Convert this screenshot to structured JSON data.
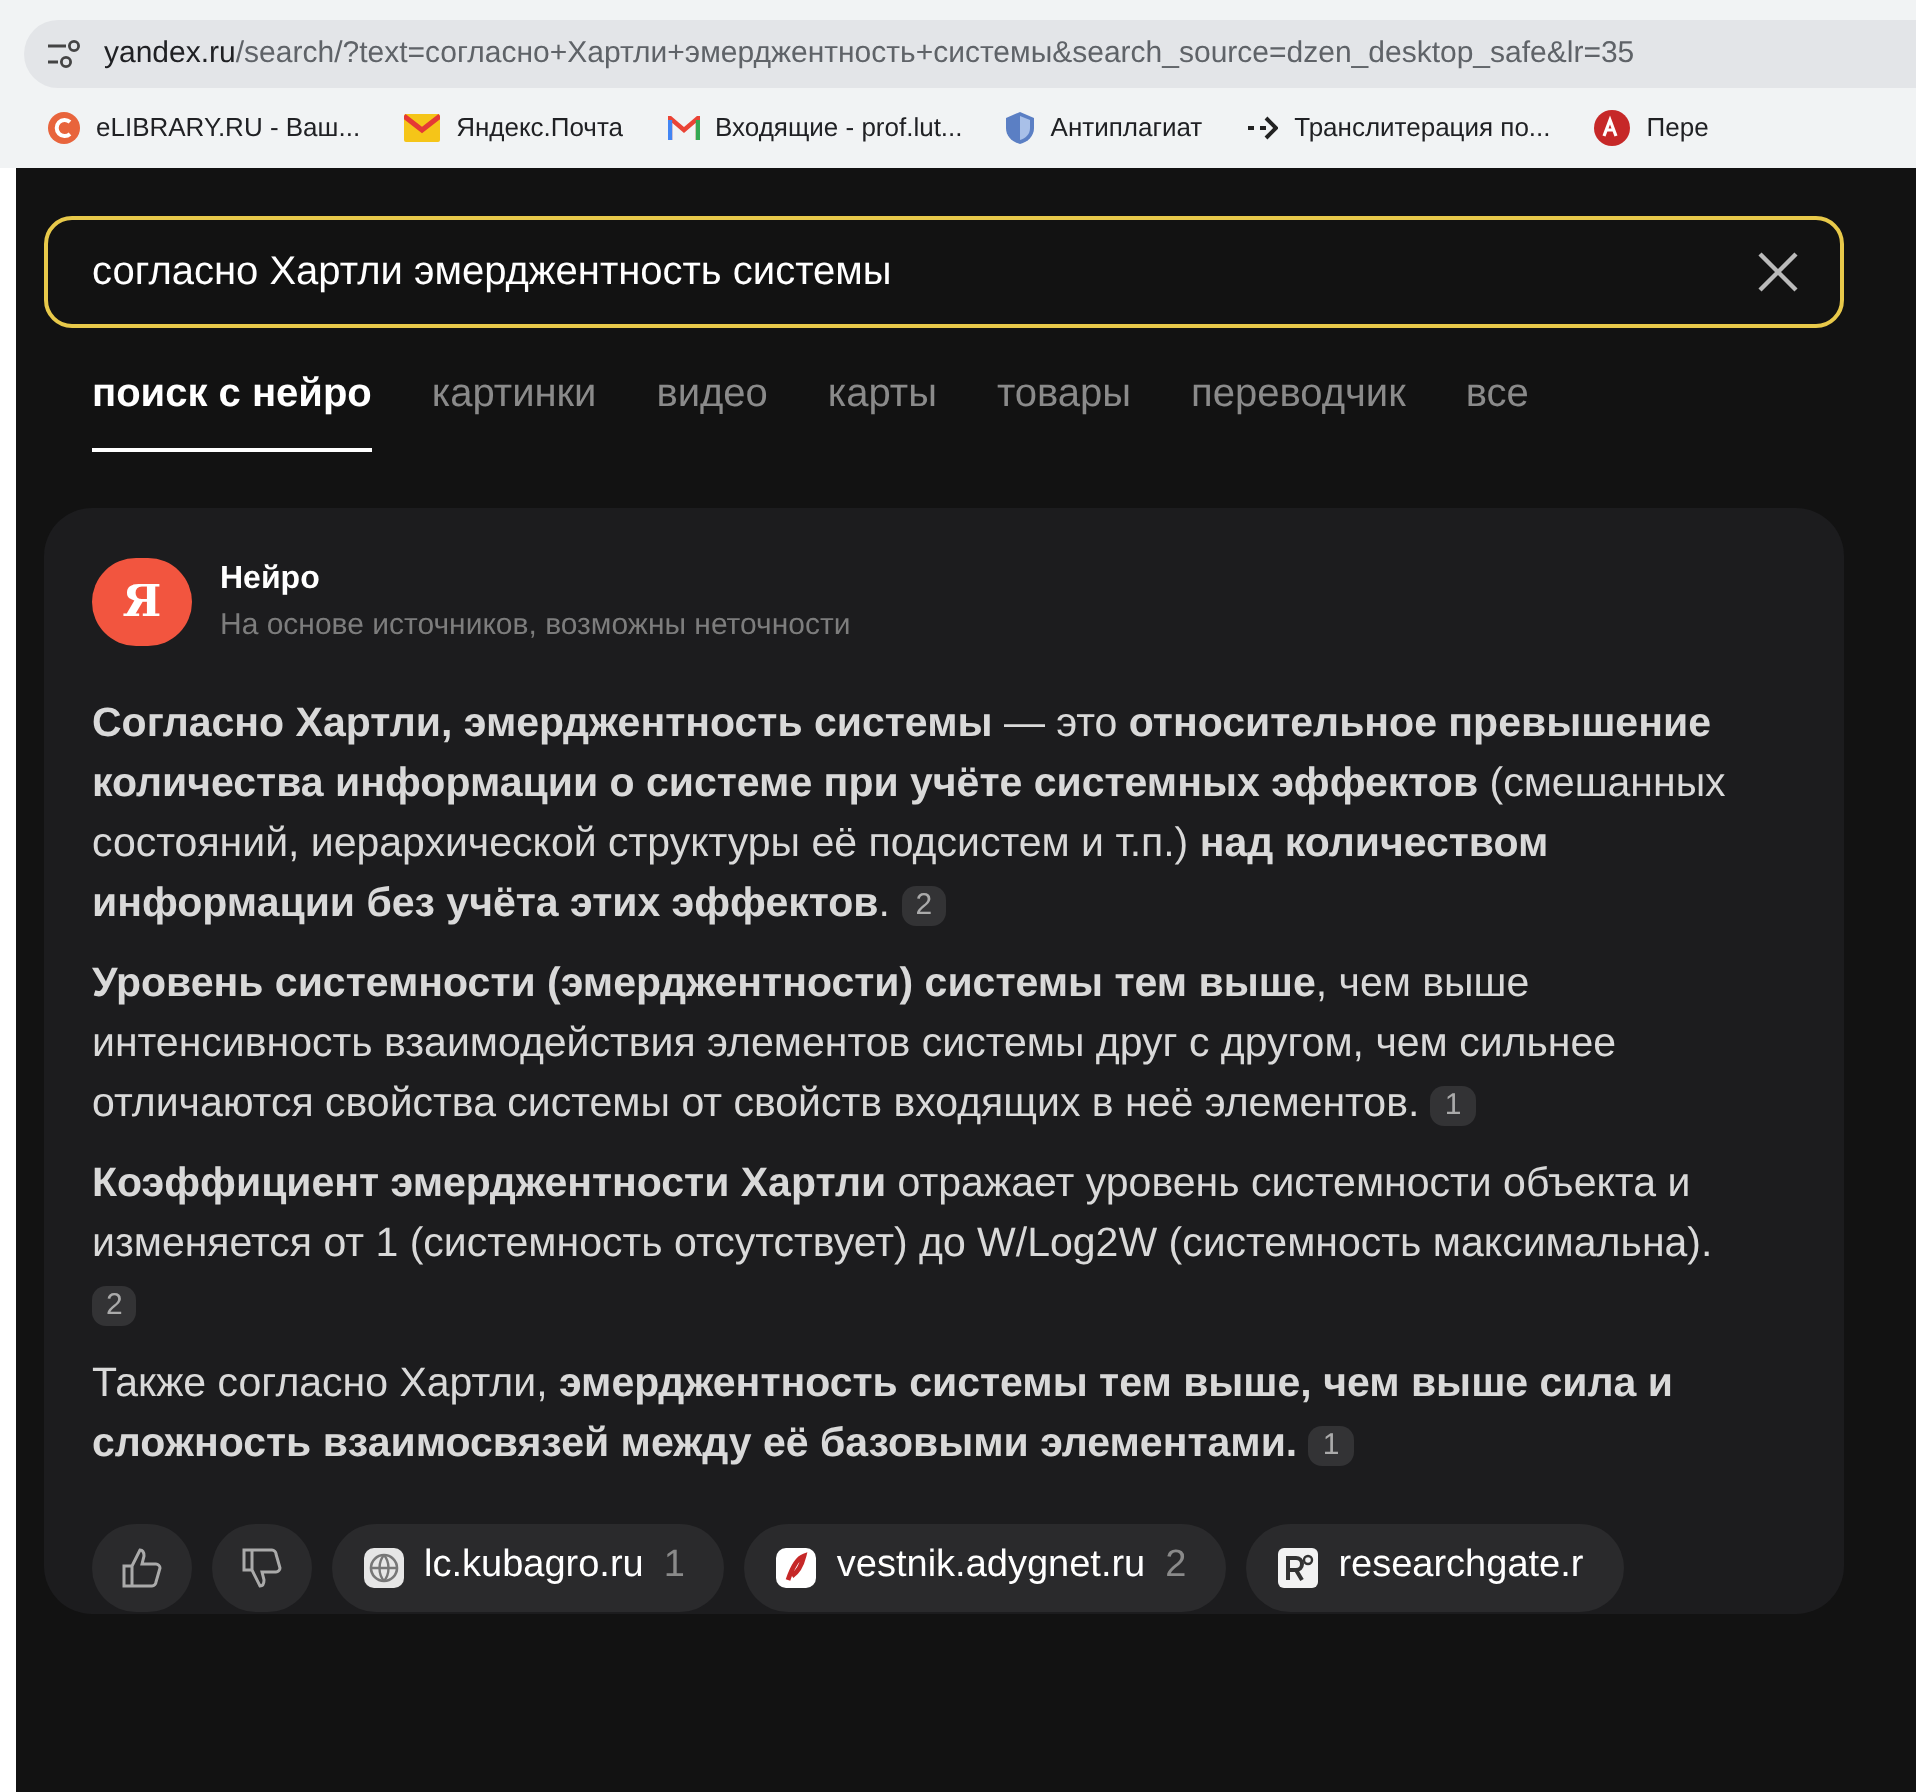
{
  "browser": {
    "address_host": "yandex.ru",
    "address_rest": "/search/?text=согласно+Хартли+эмерджентность+системы&search_source=dzen_desktop_safe&lr=35",
    "bookmarks": [
      {
        "label": "eLIBRARY.RU - Ваш...",
        "kind": "elibrary"
      },
      {
        "label": "Яндекс.Почта",
        "kind": "mail"
      },
      {
        "label": "Входящие - prof.lut...",
        "kind": "gmail"
      },
      {
        "label": "Антиплагиат",
        "kind": "shield"
      },
      {
        "label": "Транслитерация по...",
        "kind": "arrow"
      },
      {
        "label": "Пере",
        "kind": "translate"
      }
    ]
  },
  "search": {
    "value": "согласно Хартли эмерджентность системы"
  },
  "tabs": [
    {
      "label": "поиск с нейро",
      "selected": true
    },
    {
      "label": "картинки",
      "selected": false
    },
    {
      "label": "видео",
      "selected": false
    },
    {
      "label": "карты",
      "selected": false
    },
    {
      "label": "товары",
      "selected": false
    },
    {
      "label": "переводчик",
      "selected": false
    },
    {
      "label": "все",
      "selected": false
    }
  ],
  "answer": {
    "logo_letter": "Я",
    "title": "Нейро",
    "subtitle": "На основе источников, возможны неточности",
    "paragraphs": [
      {
        "text": "**Согласно Хартли, эмерджентность системы** — это **относительное превышение количества информации о системе при учёте системных эффектов** (смешанных состояний, иерархической структуры её подсистем и т.п.) **над количеством информации без учёта этих эффектов**.",
        "ref": "2"
      },
      {
        "text": "**Уровень системности (эмерджентности) системы тем выше**, чем выше интенсивность взаимодействия элементов системы друг с другом, чем сильнее отличаются свойства системы от свойств входящих в неё элементов.",
        "ref": "1"
      },
      {
        "text": "**Коэффициент эмерджентности Хартли** отражает уровень системности объекта и изменяется от 1 (системность отсутствует) до W/Log2W (системность максимальна).",
        "ref": "2"
      },
      {
        "text": "Также согласно Хартли, **эмерджентность системы тем выше, чем выше сила и сложность взаимосвязей между её базовыми элементами.**",
        "ref": "1"
      }
    ],
    "sources": [
      {
        "name": "lc.kubagro.ru",
        "count": "1",
        "kind": "globe"
      },
      {
        "name": "vestnik.adygnet.ru",
        "count": "2",
        "kind": "vestnik"
      },
      {
        "name": "researchgate.r",
        "kind": "rg"
      }
    ]
  }
}
